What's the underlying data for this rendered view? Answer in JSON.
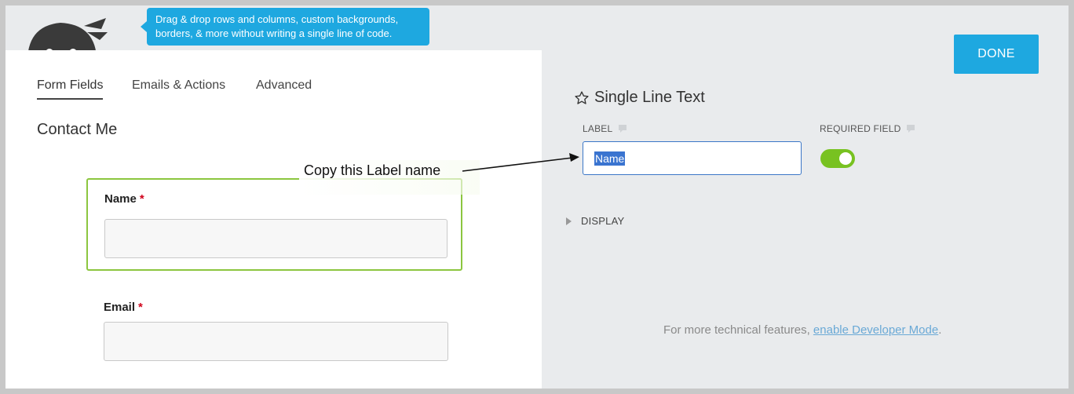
{
  "header": {
    "tooltip_line1": "Drag & drop rows and columns, custom backgrounds,",
    "tooltip_line2": "borders, & more without writing a single line of code."
  },
  "tabs": [
    {
      "label": "Form Fields",
      "active": true
    },
    {
      "label": "Emails & Actions",
      "active": false
    },
    {
      "label": "Advanced",
      "active": false
    }
  ],
  "form": {
    "title": "Contact Me",
    "fields": [
      {
        "label": "Name",
        "required_mark": "*",
        "value": ""
      },
      {
        "label": "Email",
        "required_mark": "*",
        "value": ""
      }
    ]
  },
  "annotation": {
    "text": "Copy this Label name"
  },
  "panel": {
    "done_label": "DONE",
    "title": "Single Line Text",
    "label_heading": "LABEL",
    "label_value": "Name",
    "required_heading": "REQUIRED FIELD",
    "required_on": true,
    "display_label": "DISPLAY",
    "footer_text": "For more technical features,",
    "footer_link": "enable Developer Mode",
    "footer_end": "."
  },
  "colors": {
    "accent": "#1ea8e0",
    "field_border": "#8cc63f",
    "toggle_on": "#78c221",
    "required_mark": "#d0021b"
  }
}
